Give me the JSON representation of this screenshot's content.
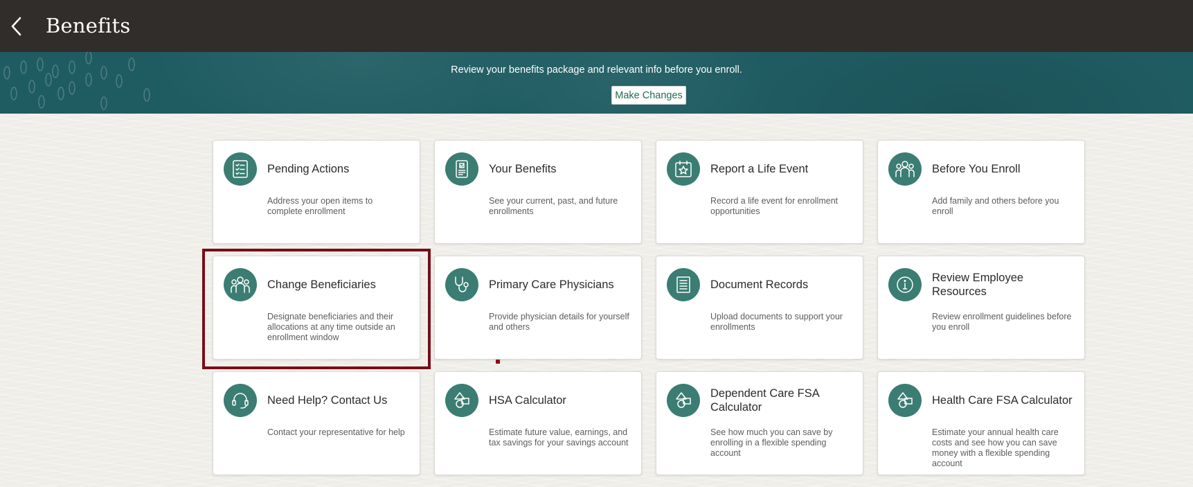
{
  "header": {
    "title": "Benefits",
    "back_icon": "chevron-left-icon"
  },
  "banner": {
    "message": "Review your benefits package and relevant info before you enroll.",
    "make_changes_label": "Make Changes"
  },
  "colors": {
    "topbar": "#312d2a",
    "banner": "#1f5c62",
    "icon_circle": "#3b7d72",
    "button_text": "#1f6b52",
    "highlight": "#7a0c17"
  },
  "tiles": [
    {
      "title": "Pending Actions",
      "description": "Address your open items to complete enrollment",
      "icon": "checklist-icon"
    },
    {
      "title": "Your Benefits",
      "description": "See your current, past, and future enrollments",
      "icon": "badge-document-icon"
    },
    {
      "title": "Report a Life Event",
      "description": "Record a life event for enrollment opportunities",
      "icon": "calendar-star-icon"
    },
    {
      "title": "Before You Enroll",
      "description": "Add family and others before you enroll",
      "icon": "family-group-icon"
    },
    {
      "title": "Change Beneficiaries",
      "description": "Designate beneficiaries and their allocations at any time outside an enrollment window",
      "icon": "people-group-icon"
    },
    {
      "title": "Primary Care Physicians",
      "description": "Provide physician details for yourself and others",
      "icon": "stethoscope-icon"
    },
    {
      "title": "Document Records",
      "description": "Upload documents to support your enrollments",
      "icon": "document-lines-icon"
    },
    {
      "title": "Review Employee Resources",
      "description": "Review enrollment guidelines before you enroll",
      "icon": "info-icon"
    },
    {
      "title": "Need Help? Contact Us",
      "description": "Contact your representative for help",
      "icon": "headset-icon"
    },
    {
      "title": "HSA Calculator",
      "description": "Estimate future value, earnings, and tax savings for your savings account",
      "icon": "calculator-shapes-icon"
    },
    {
      "title": "Dependent Care FSA Calculator",
      "description": "See how much you can save by enrolling in a flexible spending account",
      "icon": "calculator-shapes-icon"
    },
    {
      "title": "Health Care FSA Calculator",
      "description": "Estimate your annual health care costs and see how you can save money with a flexible spending account",
      "icon": "calculator-shapes-icon"
    }
  ]
}
